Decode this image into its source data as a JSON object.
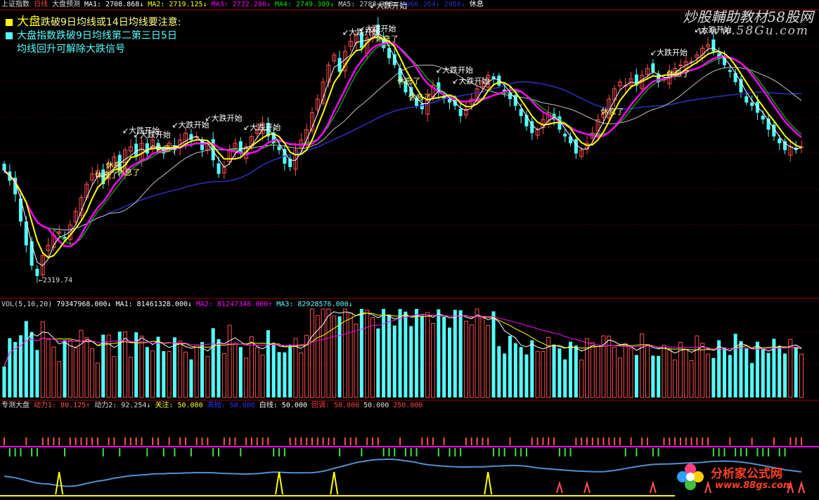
{
  "header_main": {
    "name": "上证指数",
    "period": "日线",
    "indicator": "大盘预测",
    "ma1": "MA1: 2708.868↓",
    "ma2": "MA2: 2719.125↓",
    "ma3": "MA3: 2722.286↓",
    "ma4": "MA4: 2749.309↓",
    "ma5": "MA5: 2788.398↓",
    "ma6": "2966.264↓",
    "ma7": "2950↓",
    "signal": "休息"
  },
  "legend": {
    "line1_title": "大盘",
    "line1_text": "跌破9日均线或14日均线要注意:",
    "line2_text": "大盘指数跌破9日均线第二第三日5日",
    "line3_text": "均线回升可解除大跌信号"
  },
  "watermark": {
    "text1": "炒股輔助教材58股网",
    "text2": "www.58Gu.com"
  },
  "annotations": {
    "low_label": "←2319.74",
    "labels": [
      "↙大跌开始",
      "↙大跌开始",
      "↙大跌开始",
      "休息了",
      "休息了",
      "↙大跌开始",
      "↙大跌开始",
      "休息了",
      "休息了",
      "↙大跌开始",
      "↙大跌开始",
      "休息了",
      "↙大跌开始",
      "↙大跌开始",
      "↙大跌开始",
      "休息了",
      "休息了",
      "休息了",
      "↙大跌开始",
      "休息了",
      "↙大跌开始"
    ]
  },
  "header_vol": {
    "name": "VOL(5,10,20)",
    "vol": "79347968.000↓",
    "ma1": "MA1: 81461328.000↓",
    "ma2": "MA2: 81247348.000↑",
    "ma3": "MA3: 82928576.000↓"
  },
  "header_ind": {
    "name": "专测大盘",
    "dl1": "动力1: 80.125↑",
    "dl2": "动力2: 92.254↓",
    "gz": "关注: 50.000",
    "t1": "高抛: 50.000",
    "bx": "白线: 50.000",
    "ht": "回调: 50.000",
    "v1": "50.000",
    "v2": "250.000"
  },
  "colors": {
    "up": "#ff5050",
    "down": "#54ffff",
    "ma1": "#ffffff",
    "ma2": "#ffff00",
    "ma3": "#ff00ff",
    "ma4": "#00e000",
    "ma5": "#c0c0c0",
    "ma6": "#3030c0",
    "grid": "#800000",
    "separator": "#a00000"
  },
  "chart_data": {
    "type": "candlestick",
    "title": "上证指数 日线",
    "low_marker": 2319.74,
    "ylim": [
      2270,
      3100
    ],
    "closes": [
      2640,
      2610,
      2570,
      2490,
      2420,
      2360,
      2330,
      2390,
      2420,
      2450,
      2460,
      2440,
      2480,
      2520,
      2560,
      2600,
      2630,
      2640,
      2600,
      2660,
      2680,
      2640,
      2700,
      2710,
      2680,
      2720,
      2690,
      2730,
      2700,
      2690,
      2720,
      2700,
      2730,
      2750,
      2730,
      2740,
      2700,
      2720,
      2670,
      2630,
      2650,
      2700,
      2720,
      2690,
      2710,
      2740,
      2760,
      2780,
      2740,
      2720,
      2700,
      2660,
      2650,
      2700,
      2730,
      2760,
      2810,
      2850,
      2900,
      2950,
      2980,
      2930,
      2990,
      3020,
      3040,
      3000,
      3030,
      3060,
      3040,
      3000,
      2970,
      2950,
      2900,
      2870,
      2860,
      2830,
      2820,
      2860,
      2890,
      2870,
      2850,
      2840,
      2830,
      2800,
      2820,
      2850,
      2880,
      2900,
      2920,
      2910,
      2890,
      2870,
      2850,
      2830,
      2800,
      2770,
      2750,
      2760,
      2790,
      2810,
      2790,
      2760,
      2740,
      2720,
      2690,
      2700,
      2720,
      2750,
      2790,
      2810,
      2850,
      2880,
      2900,
      2890,
      2910,
      2890,
      2920,
      2940,
      2930,
      2900,
      2910,
      2930,
      2940,
      2950,
      2960,
      2960,
      2980,
      3000,
      3010,
      2990,
      2970,
      2950,
      2930,
      2900,
      2870,
      2840,
      2830,
      2810,
      2790,
      2760,
      2740,
      2720,
      2700,
      2710,
      2700,
      2710
    ]
  }
}
